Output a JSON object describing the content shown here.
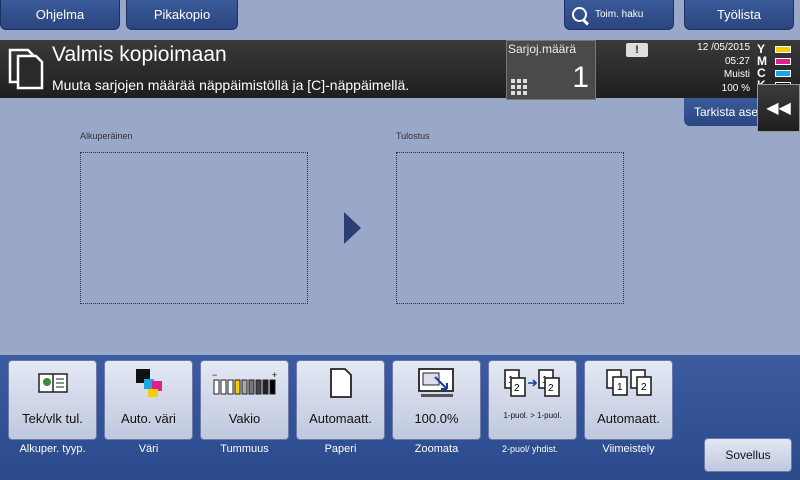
{
  "top_tabs": {
    "program": "Ohjelma",
    "quick_copy": "Pikakopio",
    "search": "Toim. haku",
    "job_list": "Työlista"
  },
  "status": {
    "title": "Valmis kopioimaan",
    "message": "Muuta sarjojen määrää näppäimistöllä ja [C]-näppäimellä.",
    "sets_label": "Sarjoj.määrä",
    "sets_value": "1",
    "warning": "!",
    "date": "12 /05/2015",
    "time": "05:27",
    "memory_label": "Muisti",
    "memory_value": "100 %",
    "toner": [
      {
        "letter": "Y",
        "color": "#f4d000"
      },
      {
        "letter": "M",
        "color": "#e0208a"
      },
      {
        "letter": "C",
        "color": "#1aa6e0"
      },
      {
        "letter": "K",
        "color": "#111111"
      }
    ]
  },
  "check_settings": "Tarkista asetukset",
  "preview": {
    "original_label": "Alkuperäinen",
    "output_label": "Tulostus"
  },
  "functions": [
    {
      "value": "Tek/vlk tul.",
      "label": "Alkuper. tyyp.",
      "icon": "book-icon"
    },
    {
      "value": "Auto. väri",
      "label": "Väri",
      "icon": "color-icon"
    },
    {
      "value": "Vakio",
      "label": "Tummuus",
      "icon": "density-icon"
    },
    {
      "value": "Automaatt.",
      "label": "Paperi",
      "icon": "paper-icon"
    },
    {
      "value": "100.0%",
      "label": "Zoomata",
      "icon": "zoom-icon"
    },
    {
      "value": "1-puol. > 1-puol.",
      "label": "2-puol/ yhdist.",
      "icon": "duplex-icon"
    },
    {
      "value": "Automaatt.",
      "label": "Viimeistely",
      "icon": "finishing-icon"
    }
  ],
  "apply": "Sovellus"
}
